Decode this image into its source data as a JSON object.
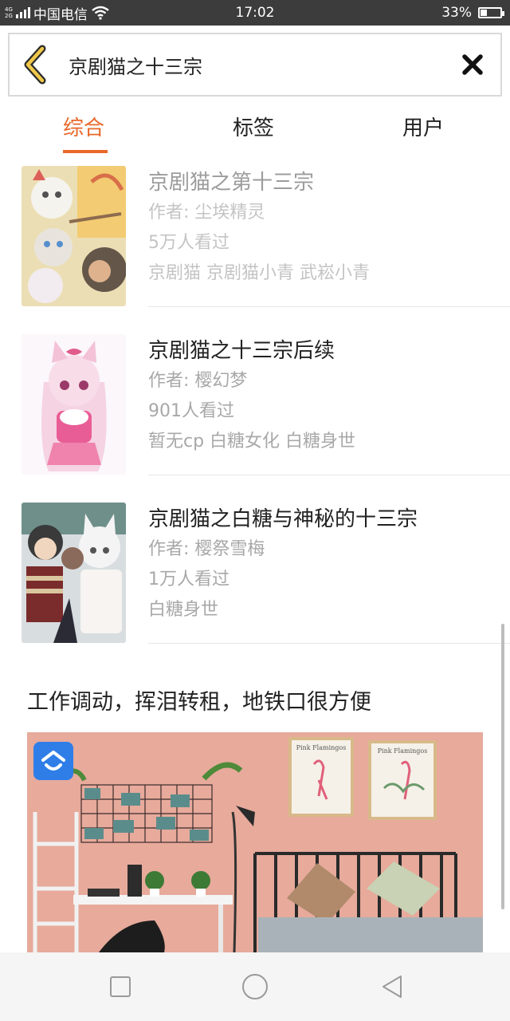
{
  "status_bar": {
    "network": [
      "4G",
      "2G"
    ],
    "carrier": "中国电信",
    "time": "17:02",
    "battery_text": "33%",
    "battery_level": 0.33
  },
  "search": {
    "query": "京剧猫之十三宗",
    "back_icon": "chevron-left-icon",
    "close_icon": "close-icon"
  },
  "tabs": [
    {
      "label": "综合",
      "active": true
    },
    {
      "label": "标签",
      "active": false
    },
    {
      "label": "用户",
      "active": false
    }
  ],
  "results": [
    {
      "title": "京剧猫之第十三宗",
      "author": "作者: 尘埃精灵",
      "views": "5万人看过",
      "tags": "京剧猫 京剧猫小青 武崧小青"
    },
    {
      "title": "京剧猫之十三宗后续",
      "author": "作者: 樱幻梦",
      "views": "901人看过",
      "tags": "暂无cp 白糖女化 白糖身世"
    },
    {
      "title": "京剧猫之白糖与神秘的十三宗",
      "author": "作者: 樱祭雪梅",
      "views": "1万人看过",
      "tags": "白糖身世"
    }
  ],
  "ad": {
    "title": "工作调动，挥泪转租，地铁口很方便",
    "poster_text_1": "Pink Flamingos",
    "poster_text_2": "Pink Flamingos"
  },
  "colors": {
    "accent": "#e8682a",
    "status_bar": "#3c3c3c",
    "ad_logo": "#2f7ee8"
  }
}
